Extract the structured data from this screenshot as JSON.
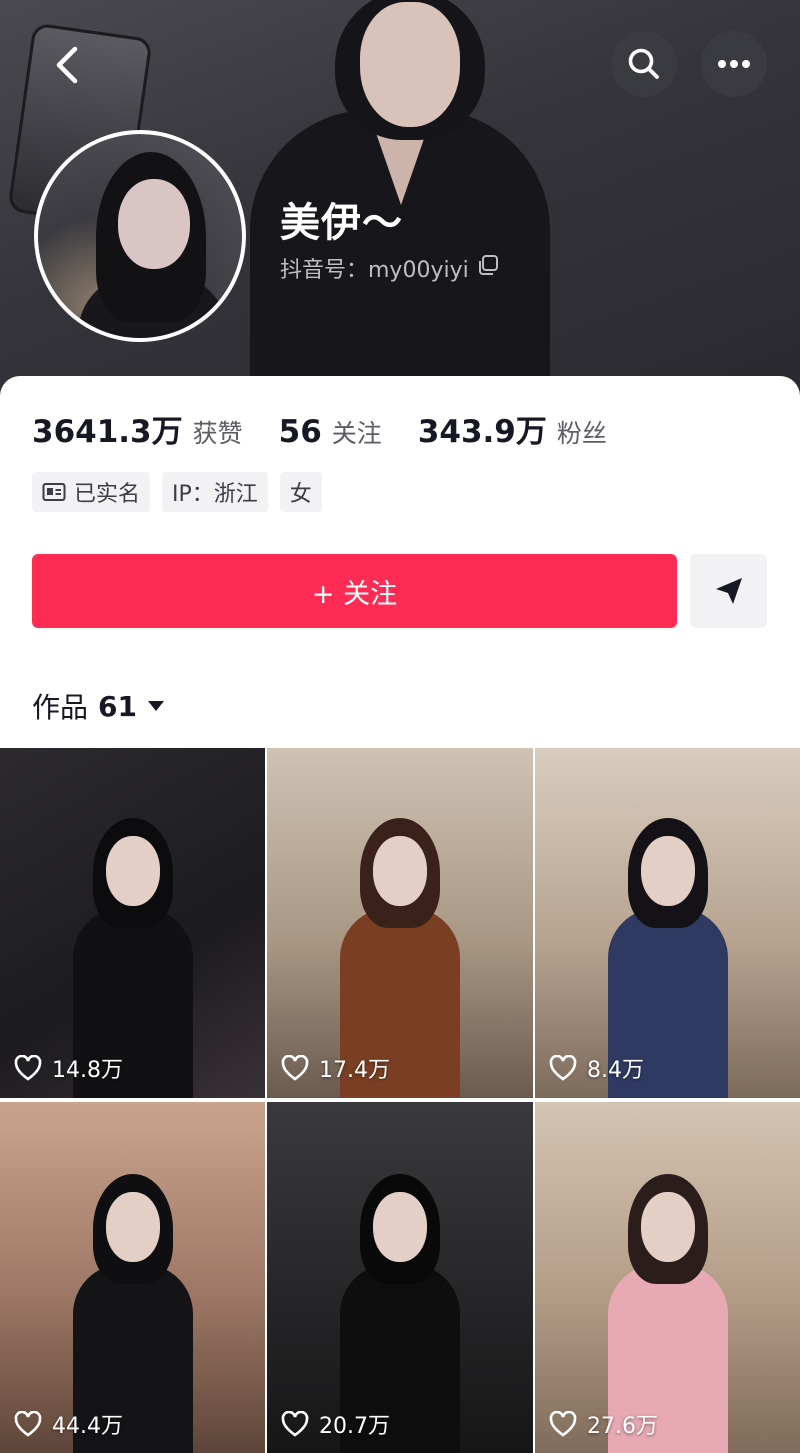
{
  "header": {
    "nickname": "美伊～",
    "douyin_id": "抖音号：my00yiyi"
  },
  "stats": [
    {
      "value": "3641.3万",
      "label": "获赞"
    },
    {
      "value": "56",
      "label": "关注"
    },
    {
      "value": "343.9万",
      "label": "粉丝"
    }
  ],
  "tags": [
    {
      "label": "已实名",
      "icon": "id-card-icon"
    },
    {
      "label": "IP：浙江"
    },
    {
      "label": "女"
    }
  ],
  "actions": {
    "follow_label": "+ 关注"
  },
  "works": {
    "label": "作品",
    "count": "61"
  },
  "videos": [
    {
      "likes": "14.8万"
    },
    {
      "likes": "17.4万"
    },
    {
      "likes": "8.4万"
    },
    {
      "likes": "44.4万"
    },
    {
      "likes": "20.7万"
    },
    {
      "likes": "27.6万"
    }
  ],
  "colors": {
    "accent": "#fe2c55",
    "text": "#161823",
    "muted": "#5c5d66",
    "tag_bg": "#f2f2f4"
  }
}
